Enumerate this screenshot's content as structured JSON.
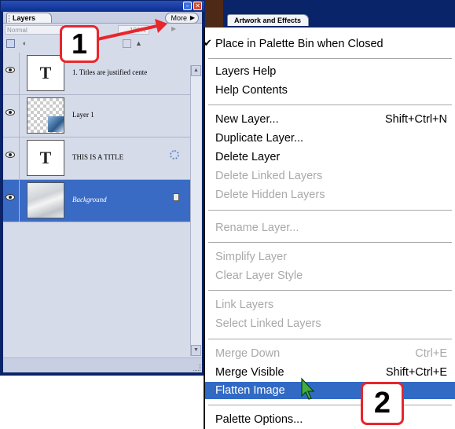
{
  "layers_panel": {
    "tab_label": "Layers",
    "more_button": "More",
    "blend_mode": "Normal",
    "opacity": "100%",
    "layers": [
      {
        "name": "1.  Titles are justified cente",
        "thumb": "text",
        "glyph": "T",
        "selected": false
      },
      {
        "name": "Layer 1",
        "thumb": "image",
        "glyph": "",
        "selected": false
      },
      {
        "name": "THIS IS A TITLE",
        "thumb": "text",
        "glyph": "T",
        "selected": false,
        "badge_icon": "effects-icon"
      },
      {
        "name": "Background",
        "thumb": "marble",
        "glyph": "",
        "selected": true,
        "badge_icon": "lock-icon"
      }
    ]
  },
  "artwork_panel": {
    "tab_label": "Artwork and Effects"
  },
  "callouts": {
    "one": "1",
    "two": "2"
  },
  "menu": {
    "items": [
      {
        "label": "Place in Palette Bin when Closed",
        "shortcut": "",
        "checked": true,
        "disabled": false
      },
      {
        "label": "Layers Help",
        "shortcut": "",
        "disabled": false
      },
      {
        "label": "Help Contents",
        "shortcut": "",
        "disabled": false
      },
      {
        "label": "New Layer...",
        "shortcut": "Shift+Ctrl+N",
        "disabled": false
      },
      {
        "label": "Duplicate Layer...",
        "shortcut": "",
        "disabled": false
      },
      {
        "label": "Delete Layer",
        "shortcut": "",
        "disabled": false
      },
      {
        "label": "Delete Linked Layers",
        "shortcut": "",
        "disabled": true
      },
      {
        "label": "Delete Hidden Layers",
        "shortcut": "",
        "disabled": true
      },
      {
        "label": "Rename Layer...",
        "shortcut": "",
        "disabled": true
      },
      {
        "label": "Simplify Layer",
        "shortcut": "",
        "disabled": true
      },
      {
        "label": "Clear Layer Style",
        "shortcut": "",
        "disabled": true
      },
      {
        "label": "Link Layers",
        "shortcut": "",
        "disabled": true
      },
      {
        "label": "Select Linked Layers",
        "shortcut": "",
        "disabled": true
      },
      {
        "label": "Merge Down",
        "shortcut": "Ctrl+E",
        "disabled": true
      },
      {
        "label": "Merge Visible",
        "shortcut": "Shift+Ctrl+E",
        "disabled": false
      },
      {
        "label": "Flatten Image",
        "shortcut": "",
        "disabled": false,
        "highlighted": true
      },
      {
        "label": "Palette Options...",
        "shortcut": "",
        "disabled": false
      }
    ]
  },
  "colors": {
    "accent": "#316ac5",
    "callout_border": "#e8262b",
    "arrow": "#e8262b"
  }
}
